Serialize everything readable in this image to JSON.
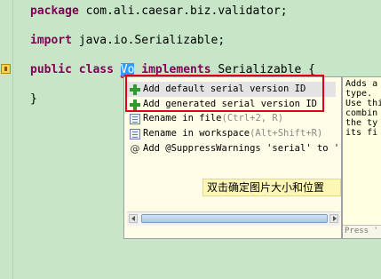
{
  "code": {
    "package_kw": "package",
    "package_name": "com.ali.caesar.biz.validator;",
    "import_kw": "import",
    "import_name": "java.io.Serializable;",
    "public_kw": "public",
    "class_kw": "class",
    "class_name": "Vo",
    "implements_kw": "implements",
    "interface_name": "Serializable {",
    "close_brace": "}"
  },
  "quickfix": {
    "proposals": [
      {
        "icon": "plus-icon",
        "label": "Add default serial version ID",
        "shortcut": ""
      },
      {
        "icon": "plus-icon",
        "label": "Add generated serial version ID",
        "shortcut": ""
      },
      {
        "icon": "rename-icon",
        "label": "Rename in file ",
        "shortcut": "(Ctrl+2, R)"
      },
      {
        "icon": "rename-icon",
        "label": "Rename in workspace ",
        "shortcut": "(Alt+Shift+R)"
      },
      {
        "icon": "at-icon",
        "label": "Add @SuppressWarnings 'serial' to 'Vo'",
        "shortcut": ""
      }
    ],
    "selected_index": 0
  },
  "hint_text": "双击确定图片大小和位置",
  "doc": {
    "lines": [
      "Adds a",
      "type.",
      "",
      "Use thi",
      "combin",
      "the ty",
      "its fi"
    ],
    "footer": "Press '"
  },
  "colors": {
    "editor_bg": "#c7e6c7",
    "keyword": "#7f0055",
    "highlight_box": "#e0001a",
    "hint_bg": "#fdf7b7"
  }
}
